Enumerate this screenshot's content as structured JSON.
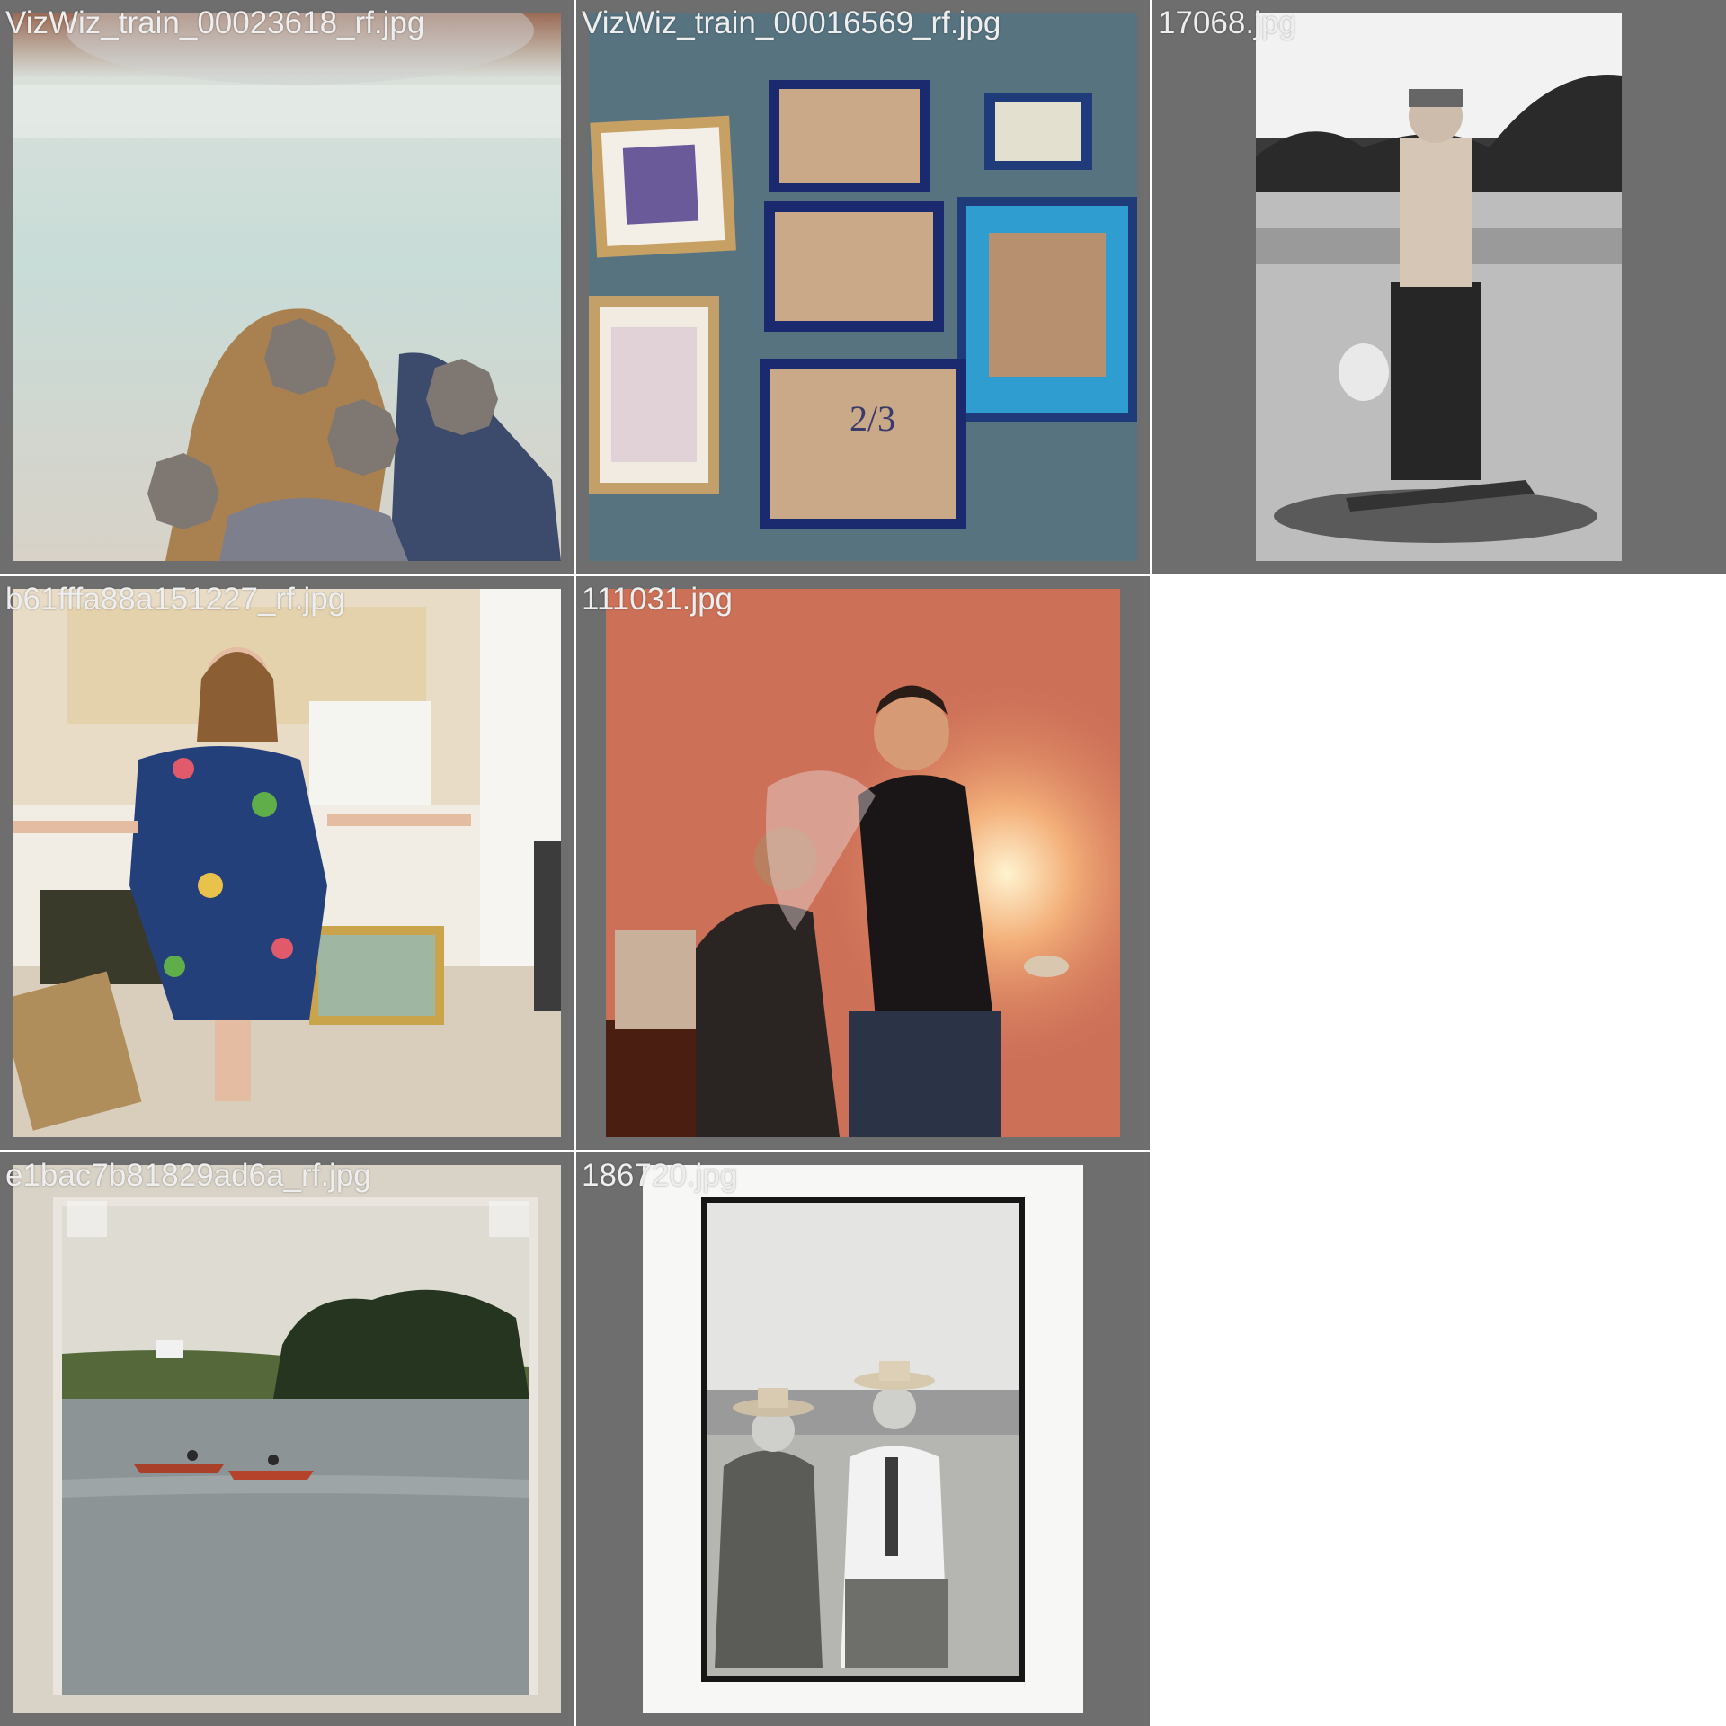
{
  "grid": {
    "background": "#6e6e6e",
    "empty_background": "#ffffff",
    "caption_color": "#eeeeee",
    "tiles": [
      {
        "filename": "VizWiz_train_00023618_rf.jpg",
        "icon": "blurry-family-photo-icon"
      },
      {
        "filename": "VizWiz_train_00016569_rf.jpg",
        "icon": "picture-frames-icon"
      },
      {
        "filename": "17068.jpg",
        "icon": "skateboarder-photo-icon"
      },
      {
        "filename": "b61fffa88a151227_rf.jpg",
        "icon": "woman-in-kitchen-photo-icon"
      },
      {
        "filename": "111031.jpg",
        "icon": "party-photo-icon"
      },
      {
        "filename": "e1bac7b81829ad6a_rf.jpg",
        "icon": "lake-canoes-photo-icon"
      },
      {
        "filename": "186720.jpg",
        "icon": "two-men-vintage-photo-icon"
      }
    ]
  }
}
